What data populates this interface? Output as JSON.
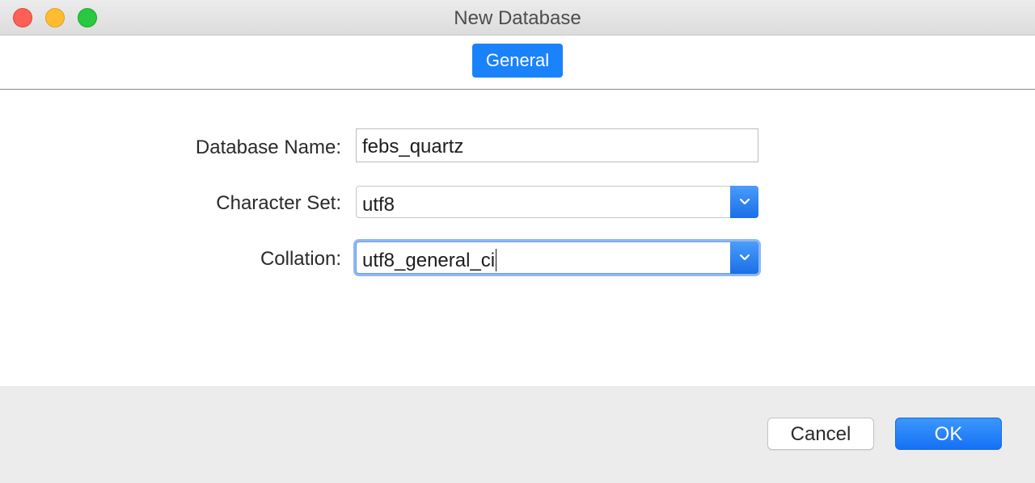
{
  "window": {
    "title": "New Database"
  },
  "tabs": [
    {
      "label": "General",
      "selected": true
    }
  ],
  "form": {
    "database_name": {
      "label": "Database Name:",
      "value": "febs_quartz"
    },
    "character_set": {
      "label": "Character Set:",
      "value": "utf8"
    },
    "collation": {
      "label": "Collation:",
      "value": "utf8_general_ci"
    }
  },
  "footer": {
    "cancel_label": "Cancel",
    "ok_label": "OK"
  },
  "colors": {
    "accent": "#1a82fb",
    "close": "#fe5f57",
    "minimize": "#febc2e",
    "zoom": "#28c840"
  },
  "icons": {
    "select_arrow": "chevron-down-icon"
  }
}
